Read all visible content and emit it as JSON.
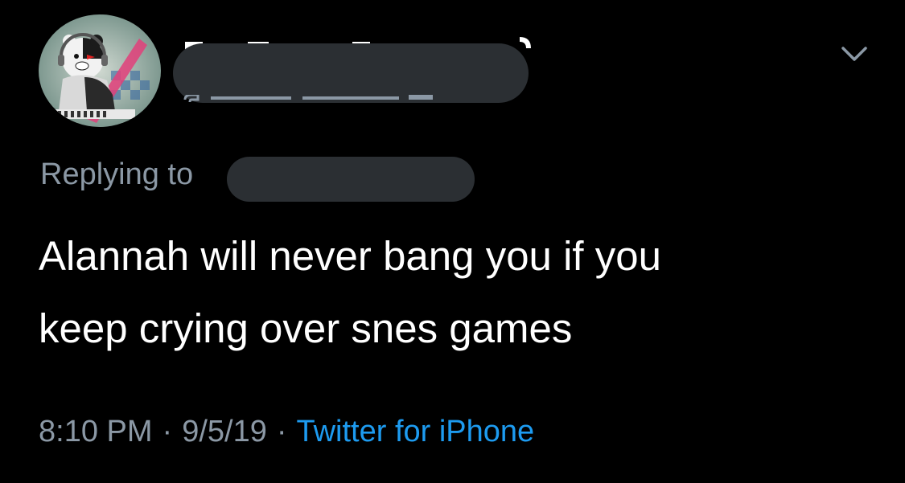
{
  "colors": {
    "background": "#000000",
    "text_primary": "#ffffff",
    "text_secondary": "#8b98a5",
    "link": "#1d9bf0",
    "redaction": "#2b2f33"
  },
  "tweet": {
    "avatar_icon": "avatar-icon",
    "more_icon": "chevron-down-icon",
    "reply_prefix": "Replying to",
    "text_lines": [
      "Alannah will never bang you if you",
      "keep crying over snes games"
    ],
    "time": "8:10 PM",
    "date": "9/5/19",
    "separator": "·",
    "source": "Twitter for iPhone"
  }
}
